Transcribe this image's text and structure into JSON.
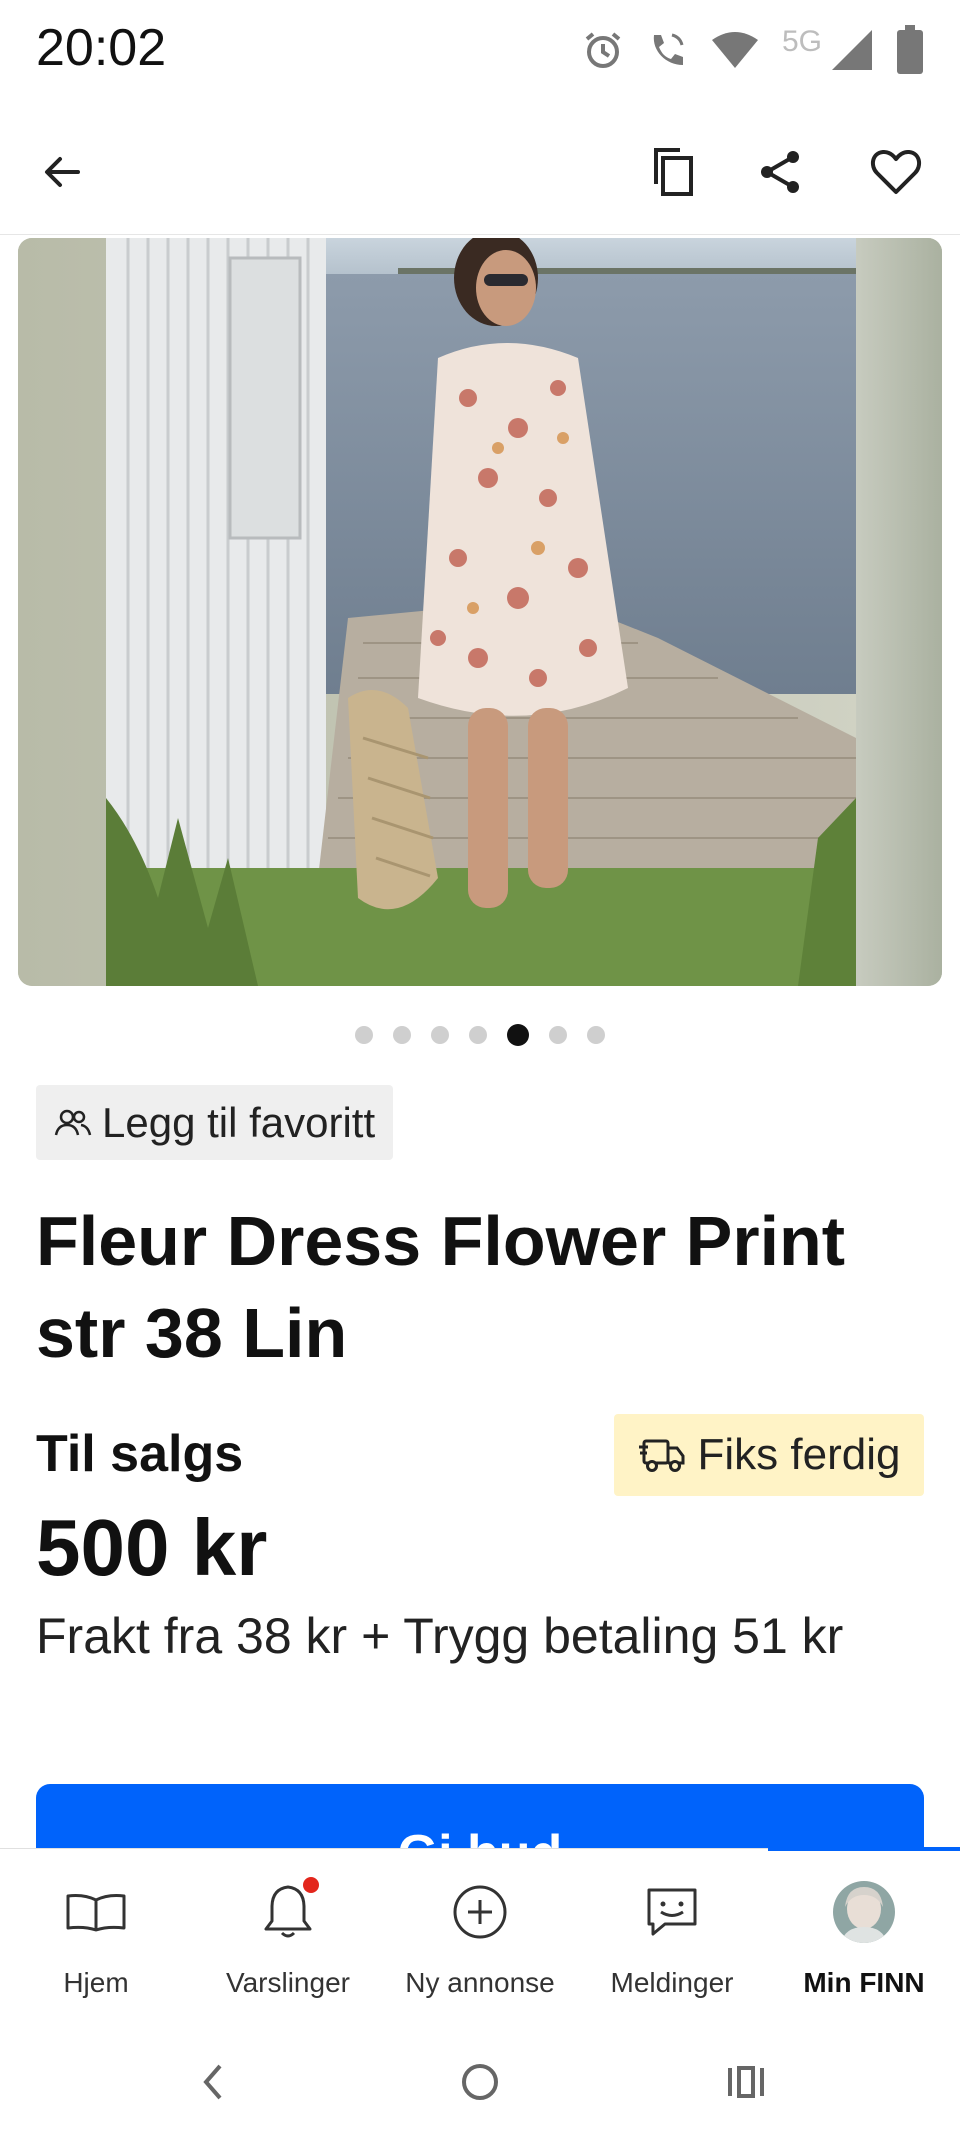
{
  "status_bar": {
    "time": "20:02",
    "network": "5G",
    "icons": [
      "alarm-icon",
      "wifi-calling-icon",
      "wifi-icon",
      "signal-icon",
      "battery-icon"
    ]
  },
  "app_bar": {
    "icons": [
      "back-arrow-icon",
      "copy-icon",
      "share-icon",
      "heart-icon"
    ]
  },
  "gallery": {
    "dot_count": 7,
    "active_index": 4
  },
  "favorite": {
    "label": "Legg til favoritt"
  },
  "listing": {
    "title": "Fleur Dress Flower Print str 38 Lin",
    "status": "Til salgs",
    "badge": "Fiks ferdig",
    "price": "500 kr",
    "shipping": "Frakt fra 38 kr + Trygg betaling 51 kr",
    "cta": "Gi bud"
  },
  "bottom_nav": {
    "items": [
      {
        "label": "Hjem",
        "icon": "book-icon"
      },
      {
        "label": "Varslinger",
        "icon": "bell-icon"
      },
      {
        "label": "Ny annonse",
        "icon": "plus-circle-icon"
      },
      {
        "label": "Meldinger",
        "icon": "chat-icon"
      },
      {
        "label": "Min FINN",
        "icon": "avatar"
      }
    ],
    "active": "Min FINN"
  },
  "colors": {
    "accent": "#0063fb",
    "badge_bg": "#fff3c6",
    "chip_bg": "#efefef",
    "notification": "#e3261c"
  }
}
